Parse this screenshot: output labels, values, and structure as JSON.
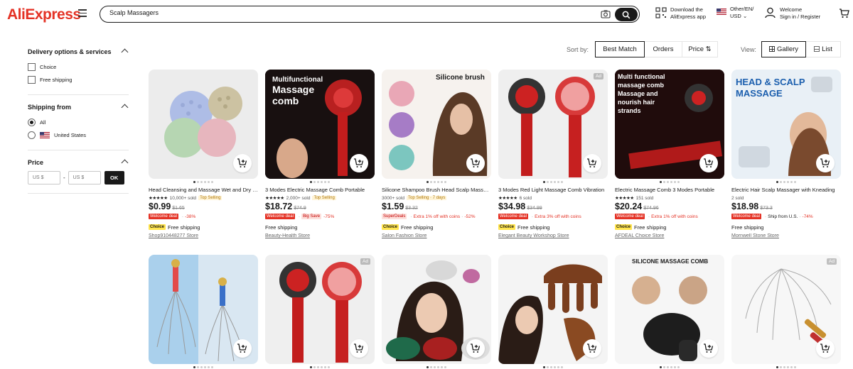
{
  "header": {
    "logo": "AliExpress",
    "search_value": "Scalp Massagers",
    "download": [
      "Download the",
      "AliExpress app"
    ],
    "locale": [
      "Other/EN/",
      "USD"
    ],
    "account": [
      "Welcome",
      "Sign in / Register"
    ]
  },
  "sidebar": {
    "delivery_title": "Delivery options & services",
    "choice": "Choice",
    "free_shipping": "Free shipping",
    "shipping_title": "Shipping from",
    "ship_all": "All",
    "ship_us": "United States",
    "price_title": "Price",
    "min_placeholder": "US $",
    "max_placeholder": "US $",
    "dash": "-",
    "ok": "OK"
  },
  "sort": {
    "label": "Sort by:",
    "best_match": "Best Match",
    "orders": "Orders",
    "price": "Price ⇅",
    "view_label": "View:",
    "gallery": "Gallery",
    "list": "List"
  },
  "products": [
    {
      "title": "Head Cleansing and Massage Wet and Dry Shampoo Brush",
      "stars": "★★★★★",
      "rating": "10,000+ sold",
      "top": "Top Selling",
      "price": "$0.99",
      "orig": "$1.65",
      "badge": "Welcome deal",
      "off": "-38%",
      "extra": "",
      "choice": true,
      "ship": "Free shipping",
      "store": "Shop910448277 Store"
    },
    {
      "title": "3 Modes Electric Massage Comb Portable",
      "stars": "★★★★★",
      "rating": "2,000+ sold",
      "top": "Top Selling",
      "price": "$18.72",
      "orig": "$74.9",
      "badge": "Welcome deal",
      "off": "-75%",
      "extra": "Big Save",
      "choice": false,
      "ship": "Free shipping",
      "store": "Beauty-Health Store"
    },
    {
      "title": "Silicone Shampoo Brush Head Scalp Massage",
      "stars": "",
      "rating": "3000+ sold",
      "top": "Top Selling · 7 days",
      "price": "$1.59",
      "orig": "$3.32",
      "badge": "SuperDeals",
      "off": "-52%",
      "extra": "Extra 1% off with coins",
      "choice": true,
      "ship": "Free shipping",
      "store": "Salon Fashion Store"
    },
    {
      "title": "3 Modes Red Light Massage Comb Vibration",
      "stars": "★★★★★",
      "rating": "6 sold",
      "top": "",
      "price": "$34.98",
      "orig": "$34.99",
      "badge": "Welcome deal",
      "off": "",
      "extra": "Extra 3% off with coins",
      "choice": true,
      "ship": "Free shipping",
      "store": "Elegant Beauty Workshop Store"
    },
    {
      "title": "Electric Massage Comb 3 Modes Portable",
      "stars": "★★★★★",
      "rating": "151 sold",
      "top": "",
      "price": "$20.24",
      "orig": "$74.96",
      "badge": "Welcome deal",
      "off": "",
      "extra": "Extra 1% off with coins",
      "choice": true,
      "ship": "Free shipping",
      "store": "AFDEAL Choice Store"
    },
    {
      "title": "Electric Hair Scalp Massager with Kneading",
      "stars": "",
      "rating": "2 sold",
      "top": "",
      "price": "$18.98",
      "orig": "$73.3",
      "badge": "Welcome deal",
      "off": "-74%",
      "extra": "Ship from U.S.",
      "choice": false,
      "ship": "Free shipping",
      "store": "Mornwell Stone Store"
    }
  ],
  "ad_label": "Ad"
}
